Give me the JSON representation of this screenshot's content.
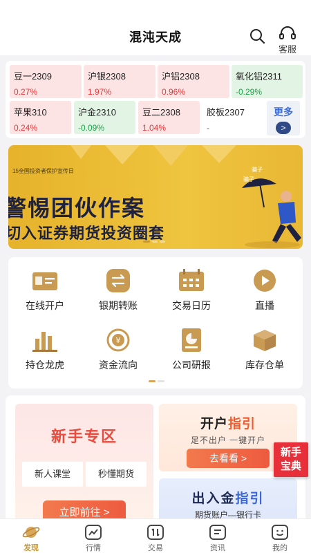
{
  "header": {
    "title": "混沌天成",
    "customer_service": "客服"
  },
  "quotes": [
    {
      "name": "豆一2309",
      "change": "0.27%",
      "trend": "up"
    },
    {
      "name": "沪银2308",
      "change": "1.97%",
      "trend": "up"
    },
    {
      "name": "沪铝2308",
      "change": "0.96%",
      "trend": "up"
    },
    {
      "name": "氧化铝2311",
      "change": "-0.29%",
      "trend": "down"
    },
    {
      "name": "苹果310",
      "change": "0.24%",
      "trend": "up"
    },
    {
      "name": "沪金2310",
      "change": "-0.09%",
      "trend": "down"
    },
    {
      "name": "豆二2308",
      "change": "1.04%",
      "trend": "up"
    },
    {
      "name": "胶板2307",
      "change": "-",
      "trend": "neutral"
    }
  ],
  "more": {
    "label": "更多",
    "arrow": ">"
  },
  "banner": {
    "tagline": "15全国投资者保护宣传日",
    "line1": "警惕团伙作案",
    "line2": "切入证券期货投资圈套",
    "umbrella_1": "骗子",
    "umbrella_2": "骗子"
  },
  "menu": [
    {
      "label": "在线开户",
      "icon": "id-card-icon"
    },
    {
      "label": "银期转账",
      "icon": "transfer-icon"
    },
    {
      "label": "交易日历",
      "icon": "calendar-icon"
    },
    {
      "label": "直播",
      "icon": "play-icon"
    },
    {
      "label": "持仓龙虎",
      "icon": "bar-chart-icon"
    },
    {
      "label": "资金流向",
      "icon": "fund-flow-icon"
    },
    {
      "label": "公司研报",
      "icon": "report-icon"
    },
    {
      "label": "库存仓单",
      "icon": "box-icon"
    }
  ],
  "newbie": {
    "title_a": "新手",
    "title_b": "专区",
    "pill_1": "新人课堂",
    "pill_2": "秒懂期货",
    "cta": "立即前往 >"
  },
  "open_guide": {
    "title_a": "开户",
    "title_b": "指引",
    "subtitle": "足不出户 一键开户",
    "cta": "去看看 >"
  },
  "funds_guide": {
    "title_a": "出入金",
    "title_b": "指引",
    "subtitle": "期货账户—银行卡"
  },
  "badge": {
    "line1": "新手",
    "line2": "宝典"
  },
  "tabs": [
    {
      "label": "发现",
      "active": true
    },
    {
      "label": "行情",
      "active": false
    },
    {
      "label": "交易",
      "active": false
    },
    {
      "label": "资讯",
      "active": false
    },
    {
      "label": "我的",
      "active": false
    }
  ],
  "colors": {
    "up": "#e5393b",
    "down": "#18a34a",
    "accent": "#c79b3b",
    "banner": "#efc43e"
  }
}
